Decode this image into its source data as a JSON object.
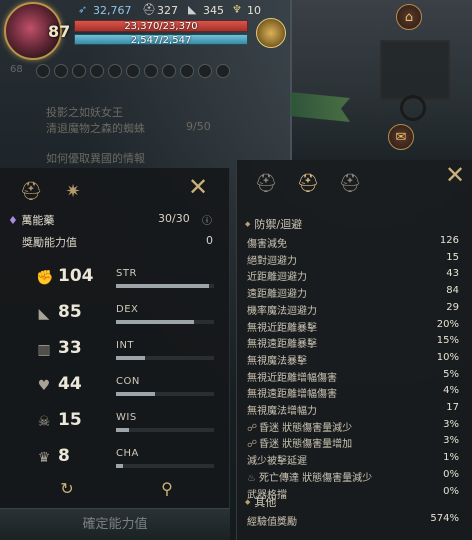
{
  "hud": {
    "level": "87",
    "currency": [
      {
        "icon": "feather-icon",
        "value": "32,767"
      },
      {
        "icon": "helmet-icon",
        "value": "327"
      },
      {
        "icon": "shoe-icon",
        "value": "345"
      },
      {
        "icon": "chalice-icon",
        "value": "10"
      }
    ],
    "hp": "23,370/23,370",
    "hp_fraction": 1.0,
    "mp": "2,547/2,547",
    "mp_fraction": 1.0,
    "side_number": "68"
  },
  "quests": [
    {
      "text": "投影之如妖女王"
    },
    {
      "text": "清退魔物之森的蜘蛛",
      "progress": "9/50"
    },
    {
      "text": "如何優取異國的情報"
    }
  ],
  "left_panel": {
    "potion_name": "萬能藥",
    "potion_count": "30/30",
    "bonus_label": "獎勵能力值",
    "bonus_value": "0",
    "stats": [
      {
        "icon": "muscle-icon",
        "value": "104",
        "name": "STR",
        "fill": 0.95
      },
      {
        "icon": "boot-icon",
        "value": "85",
        "name": "DEX",
        "fill": 0.8
      },
      {
        "icon": "book-icon",
        "value": "33",
        "name": "INT",
        "fill": 0.3
      },
      {
        "icon": "heart-icon",
        "value": "44",
        "name": "CON",
        "fill": 0.4
      },
      {
        "icon": "skull-icon",
        "value": "15",
        "name": "WIS",
        "fill": 0.13
      },
      {
        "icon": "crown-icon",
        "value": "8",
        "name": "CHA",
        "fill": 0.07
      }
    ],
    "confirm_label": "確定能力值"
  },
  "right_panel": {
    "defense_title": "防禦/迴避",
    "defense_rows": [
      {
        "label": "傷害減免",
        "value": "126"
      },
      {
        "label": "絕對迴避力",
        "value": "15"
      },
      {
        "label": "近距離迴避力",
        "value": "43"
      },
      {
        "label": "遠距離迴避力",
        "value": "84"
      },
      {
        "label": "機率魔法迴避力",
        "value": "29"
      },
      {
        "label": "無視近距離暴擊",
        "value": "20%"
      },
      {
        "label": "無視遠距離暴擊",
        "value": "15%"
      },
      {
        "label": "無視魔法暴擊",
        "value": "10%"
      },
      {
        "label": "無視近距離增幅傷害",
        "value": "5%"
      },
      {
        "label": "無視遠距離增幅傷害",
        "value": "4%"
      },
      {
        "label": "無視魔法增幅力",
        "value": "17"
      },
      {
        "label": "昏迷 狀態傷害量減少",
        "value": "3%",
        "icon": "link-icon"
      },
      {
        "label": "昏迷 狀態傷害量增加",
        "value": "3%",
        "icon": "link-icon"
      },
      {
        "label": "減少被擊延遲",
        "value": "1%"
      },
      {
        "label": "死亡傳達 狀態傷害量減少",
        "value": "0%",
        "icon": "flame-icon"
      },
      {
        "label": "武器格擋",
        "value": "0%"
      }
    ],
    "other_title": "其他",
    "other_rows": [
      {
        "label": "經驗值獎勵",
        "value": "574%"
      }
    ]
  },
  "colors": {
    "hp": "#d9554a",
    "mp": "#6fc0d8",
    "accent_gold": "#c9b27a"
  }
}
